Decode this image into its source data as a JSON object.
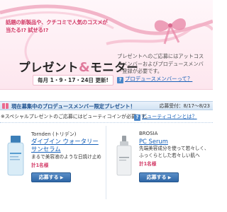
{
  "banner": {
    "tagline": "話題の新製品や、クチコミで人気のコスメが当たる!? 試せる!?",
    "title_left": "プレゼント",
    "title_amp": "&",
    "title_right": "モニター",
    "update": "毎月 1・9・17・24日 更新!",
    "description": "プレゼントへのご応募にはアットコスメメンバーおよびプロデュースメンバー登録が必要です。",
    "produce_link": "プロデュースメンバーって？"
  },
  "section": {
    "title": "現在募集中のプロデュースメンバー限定プレゼント！",
    "period": "応募受付：8/17〜8/23",
    "note": "※スペシャルプレゼントのご応募にはビューティコインが必要です。",
    "coin_link": "ビューティコインとは？"
  },
  "products": [
    {
      "brand": "Tornden (トリデン)",
      "name": "ダイブイン ウォータリー サンセラム",
      "description": "まるで美容液のような日焼け止め",
      "count": "計1名様",
      "button": "応募する",
      "image_colors": {
        "bottle": "#d9ecf7",
        "cap": "#3c7fb8"
      }
    },
    {
      "brand": "BROSIA",
      "name": "PC Serum",
      "description": "先端美容成分を使って若々しく、ふっくらとした若々しい肌へ",
      "count": "計1名様",
      "button": "応募する",
      "image_colors": {
        "bottle": "#eef0f2",
        "cap": "#c8ccd0"
      }
    }
  ],
  "icons": {
    "question": "?",
    "button_arrow": "▶"
  }
}
